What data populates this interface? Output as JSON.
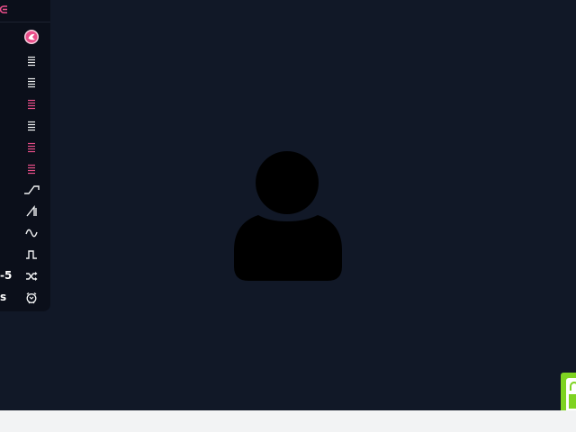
{
  "sidebar": {
    "collapse_icon": "chevron-collapse-icon",
    "logo_icon": "pink-circle-logo-icon",
    "items": [
      {
        "icon": "list-icon",
        "color": "#f2f3f4"
      },
      {
        "icon": "list-icon",
        "color": "#f2f3f4"
      },
      {
        "icon": "list-icon",
        "color": "#e94e8a"
      },
      {
        "icon": "list-icon",
        "color": "#f2f3f4"
      },
      {
        "icon": "list-icon",
        "color": "#e94e8a"
      },
      {
        "icon": "list-icon",
        "color": "#e94e8a"
      },
      {
        "icon": "ramp-wave-icon"
      },
      {
        "icon": "sawtooth-wave-icon"
      },
      {
        "icon": "sine-wave-icon"
      },
      {
        "icon": "square-wave-icon"
      },
      {
        "icon": "shuffle-icon"
      },
      {
        "icon": "alarm-clock-icon"
      }
    ],
    "row_labels": {
      "shuffle_row": "-5",
      "alarm_row": "s"
    }
  },
  "main": {
    "avatar_icon": "user-silhouette-icon"
  },
  "colors": {
    "background": "#111827",
    "sidebar": "#0b0f1a",
    "accent_pink": "#e94e8a",
    "green_tab": "#7ed321",
    "footer": "#f2f3f4"
  }
}
